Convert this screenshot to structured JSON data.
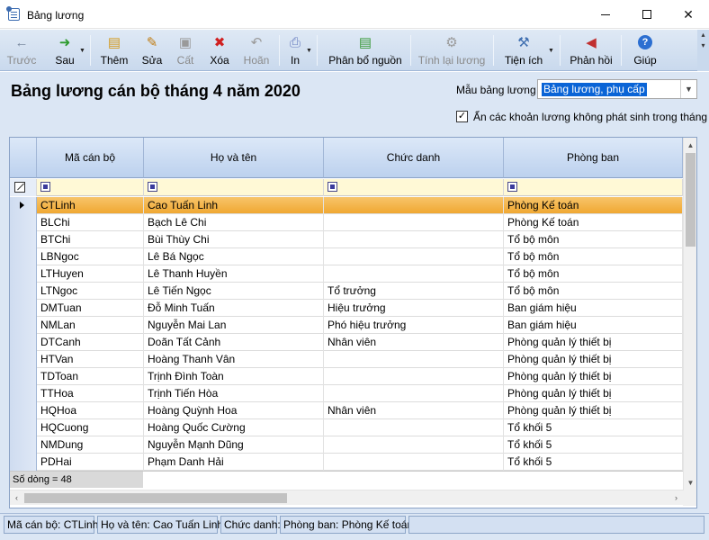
{
  "window": {
    "title": "Bảng lương"
  },
  "toolbar": {
    "items": [
      {
        "label": "Trước",
        "icon": "arrow-left-icon",
        "glyph": "←",
        "color": "#7a8aa0",
        "enabled": false
      },
      {
        "label": "Sau",
        "icon": "arrow-right-icon",
        "glyph": "➜",
        "color": "#2e9b2e",
        "enabled": true
      },
      {
        "label": "Thêm",
        "icon": "add-document-icon",
        "glyph": "🗋",
        "color": "#d39a1f",
        "enabled": true
      },
      {
        "label": "Sửa",
        "icon": "edit-icon",
        "glyph": "✎",
        "color": "#c07c12",
        "enabled": true
      },
      {
        "label": "Cất",
        "icon": "save-icon",
        "glyph": "▣",
        "color": "#8c8c8c",
        "enabled": false
      },
      {
        "label": "Xóa",
        "icon": "delete-icon",
        "glyph": "✖",
        "color": "#d02020",
        "enabled": true
      },
      {
        "label": "Hoãn",
        "icon": "undo-icon",
        "glyph": "↶",
        "color": "#8c8c8c",
        "enabled": false
      },
      {
        "label": "In",
        "icon": "printer-icon",
        "glyph": "⎙",
        "color": "#6a7fc0",
        "enabled": true
      },
      {
        "label": "Phân bổ nguồn",
        "icon": "allocate-icon",
        "glyph": "▤",
        "color": "#3a9a3a",
        "enabled": true
      },
      {
        "label": "Tính lại lương",
        "icon": "gear-icon",
        "glyph": "⚙",
        "color": "#8c8c8c",
        "enabled": false
      },
      {
        "label": "Tiện ích",
        "icon": "tools-icon",
        "glyph": "⚒",
        "color": "#3f6fb0",
        "enabled": true
      },
      {
        "label": "Phản hồi",
        "icon": "megaphone-icon",
        "glyph": "📢",
        "color": "#c03030",
        "enabled": true
      },
      {
        "label": "Giúp",
        "icon": "help-icon",
        "glyph": "?",
        "color": "#2c6fd1",
        "enabled": true
      }
    ]
  },
  "header": {
    "title": "Bảng lương cán bộ tháng 4 năm 2020",
    "template_label": "Mẫu bảng lương",
    "template_value": "Bảng lương, phụ cấp",
    "hide_checkbox_label": "Ẩn các khoản lương không phát sinh trong tháng",
    "hide_checked": "✓"
  },
  "grid": {
    "columns": [
      "Mã cán bộ",
      "Họ và tên",
      "Chức danh",
      "Phòng ban"
    ],
    "rows": [
      [
        "CTLinh",
        "Cao Tuấn Linh",
        "",
        "Phòng Kế toán"
      ],
      [
        "BLChi",
        "Bạch Lê Chi",
        "",
        "Phòng Kế toán"
      ],
      [
        "BTChi",
        "Bùi Thùy Chi",
        "",
        "Tổ bộ môn"
      ],
      [
        "LBNgoc",
        "Lê Bá Ngọc",
        "",
        "Tổ bộ môn"
      ],
      [
        "LTHuyen",
        "Lê Thanh Huyền",
        "",
        "Tổ bộ môn"
      ],
      [
        "LTNgoc",
        "Lê Tiến Ngọc",
        "Tổ trưởng",
        "Tổ bộ môn"
      ],
      [
        "DMTuan",
        "Đỗ Minh Tuấn",
        "Hiệu trưởng",
        "Ban giám hiệu"
      ],
      [
        "NMLan",
        "Nguyễn Mai Lan",
        "Phó hiệu trưởng",
        "Ban giám hiệu"
      ],
      [
        "DTCanh",
        "Doãn Tất Cảnh",
        "Nhân viên",
        "Phòng quản lý thiết bị"
      ],
      [
        "HTVan",
        "Hoàng Thanh Vân",
        "",
        "Phòng quản lý thiết bị"
      ],
      [
        "TDToan",
        "Trịnh Đình Toàn",
        "",
        "Phòng quản lý thiết bị"
      ],
      [
        "TTHoa",
        "Trịnh Tiến Hòa",
        "",
        "Phòng quản lý thiết bị"
      ],
      [
        "HQHoa",
        "Hoàng Quỳnh Hoa",
        "Nhân viên",
        "Phòng quản lý thiết bị"
      ],
      [
        "HQCuong",
        "Hoàng Quốc Cường",
        "",
        "Tổ khối 5"
      ],
      [
        "NMDung",
        "Nguyễn Mạnh Dũng",
        "",
        "Tổ khối 5"
      ],
      [
        "PDHai",
        "Phạm Danh Hải",
        "",
        "Tổ khối 5"
      ]
    ],
    "selected_row": 0,
    "row_count_text": "Số dòng = 48"
  },
  "status_bar": {
    "items": [
      "Mã cán bộ: CTLinh",
      "Họ và tên: Cao Tuấn Linh",
      "Chức danh:",
      "Phòng ban: Phòng Kế toán",
      ""
    ]
  }
}
